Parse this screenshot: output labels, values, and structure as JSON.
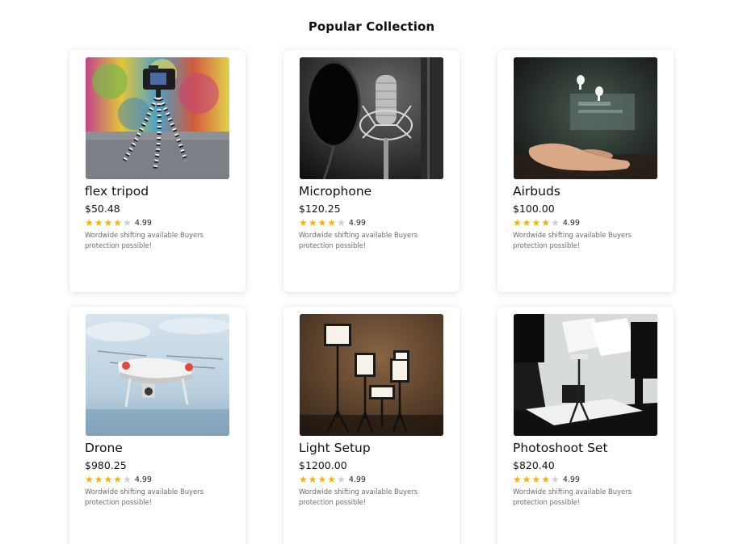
{
  "section": {
    "title": "Popular Collection"
  },
  "colors": {
    "star_filled": "#f4b400",
    "star_empty": "#cfcfcf",
    "description": "#6b6b6b"
  },
  "products": [
    {
      "name": "flex tripod",
      "price": "$50.48",
      "rating": "4.99",
      "stars_filled": 4,
      "description": "Wordwide shifting available Buyers protection possible!",
      "image": "camera-on-flexible-tripod"
    },
    {
      "name": "Microphone",
      "price": "$120.25",
      "rating": "4.99",
      "stars_filled": 4,
      "description": "Wordwide shifting available Buyers protection possible!",
      "image": "studio-microphone-with-pop-filter"
    },
    {
      "name": "Airbuds",
      "price": "$100.00",
      "rating": "4.99",
      "stars_filled": 4,
      "description": "Wordwide shifting available Buyers protection possible!",
      "image": "hand-with-floating-earbuds"
    },
    {
      "name": "Drone",
      "price": "$980.25",
      "rating": "4.99",
      "stars_filled": 4,
      "description": "Wordwide shifting available Buyers protection possible!",
      "image": "white-drone-in-sky"
    },
    {
      "name": "Light Setup",
      "price": "$1200.00",
      "rating": "4.99",
      "stars_filled": 4,
      "description": "Wordwide shifting available Buyers protection possible!",
      "image": "led-light-panels-on-stands"
    },
    {
      "name": "Photoshoot Set",
      "price": "$820.40",
      "rating": "4.99",
      "stars_filled": 4,
      "description": "Wordwide shifting available Buyers protection possible!",
      "image": "photo-studio-softbox-setup"
    }
  ]
}
